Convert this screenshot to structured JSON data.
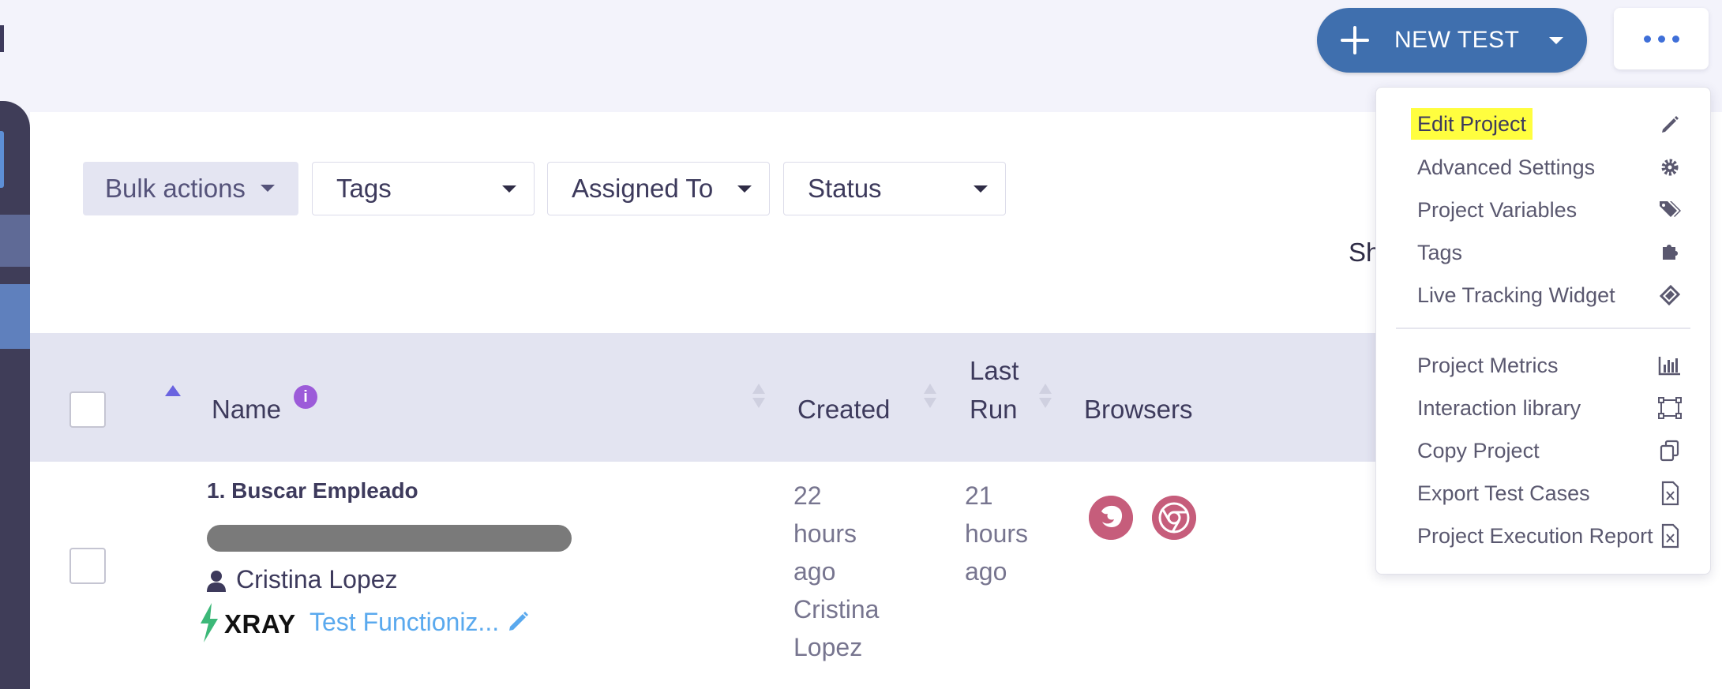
{
  "header": {
    "new_test_label": "NEW TEST"
  },
  "filters": {
    "bulk_actions": "Bulk actions",
    "tags": "Tags",
    "assigned_to": "Assigned To",
    "status": "Status"
  },
  "show_label": "Sh",
  "table": {
    "columns": {
      "name": "Name",
      "created": "Created",
      "last_run_line1": "Last",
      "last_run_line2": "Run",
      "browsers": "Browsers"
    },
    "rows": [
      {
        "name": "1. Buscar Empleado",
        "user": "Cristina Lopez",
        "xray_logo": "XRAY",
        "xray_link": "Test Functioniz...",
        "created": [
          "22",
          "hours",
          "ago",
          "Cristina",
          "Lopez"
        ],
        "last_run": [
          "21",
          "hours",
          "ago"
        ],
        "browsers": [
          "firefox-icon",
          "chrome-icon"
        ]
      }
    ]
  },
  "menu": {
    "items": [
      {
        "label": "Edit Project",
        "icon": "pencil-icon",
        "highlighted": true
      },
      {
        "label": "Advanced Settings",
        "icon": "gear-icon"
      },
      {
        "label": "Project Variables",
        "icon": "tags-icon"
      },
      {
        "label": "Tags",
        "icon": "puzzle-icon"
      },
      {
        "label": "Live Tracking Widget",
        "icon": "ticket-icon"
      },
      {
        "label": "Project Metrics",
        "icon": "bar-chart-icon"
      },
      {
        "label": "Interaction library",
        "icon": "vector-square-icon"
      },
      {
        "label": "Copy Project",
        "icon": "copy-icon"
      },
      {
        "label": "Export Test Cases",
        "icon": "excel-file-icon"
      },
      {
        "label": "Project Execution Report",
        "icon": "excel-file-icon"
      }
    ]
  },
  "colors": {
    "primary": "#3f6fae",
    "highlight": "#fffe3f",
    "sidebar": "#3f3d58",
    "link": "#5aa9ee",
    "browser_icon": "#c65d7b"
  }
}
